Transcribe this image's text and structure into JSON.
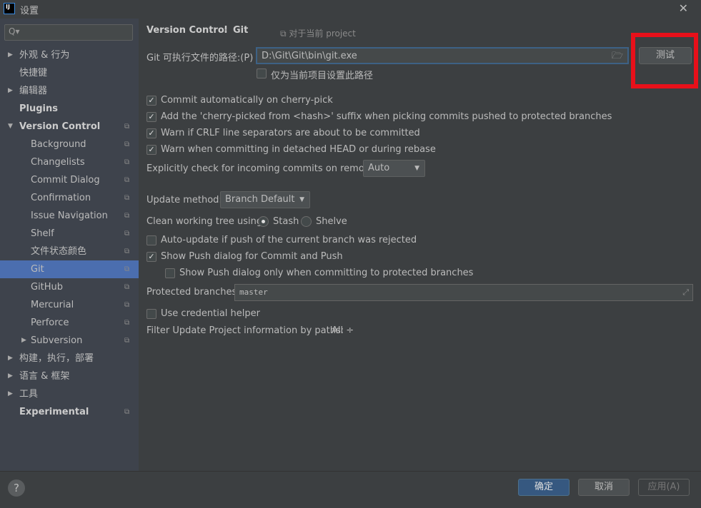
{
  "window": {
    "title": "设置",
    "logo": "IJ"
  },
  "sidebar": {
    "search_placeholder": "Q▾",
    "items": [
      {
        "label": "外观 & 行为",
        "arrow": "▶",
        "level": 0,
        "bold": false,
        "copy": false
      },
      {
        "label": "快捷键",
        "level": 0,
        "bold": false,
        "copy": false
      },
      {
        "label": "编辑器",
        "arrow": "▶",
        "level": 0,
        "bold": false,
        "copy": false
      },
      {
        "label": "Plugins",
        "level": 0,
        "bold": true,
        "copy": false
      },
      {
        "label": "Version Control",
        "arrow": "▼",
        "level": 0,
        "bold": true,
        "copy": true
      },
      {
        "label": "Background",
        "level": 1,
        "copy": true
      },
      {
        "label": "Changelists",
        "level": 1,
        "copy": true
      },
      {
        "label": "Commit Dialog",
        "level": 1,
        "copy": true
      },
      {
        "label": "Confirmation",
        "level": 1,
        "copy": true
      },
      {
        "label": "Issue Navigation",
        "level": 1,
        "copy": true
      },
      {
        "label": "Shelf",
        "level": 1,
        "copy": true
      },
      {
        "label": "文件状态颜色",
        "level": 1,
        "copy": true
      },
      {
        "label": "Git",
        "level": 1,
        "copy": true,
        "selected": true
      },
      {
        "label": "GitHub",
        "level": 1,
        "copy": true
      },
      {
        "label": "Mercurial",
        "level": 1,
        "copy": true
      },
      {
        "label": "Perforce",
        "level": 1,
        "copy": true
      },
      {
        "label": "Subversion",
        "arrow": "▶",
        "level": 1,
        "copy": true
      },
      {
        "label": "构建，执行，部署",
        "arrow": "▶",
        "level": 0
      },
      {
        "label": "语言 & 框架",
        "arrow": "▶",
        "level": 0
      },
      {
        "label": "工具",
        "arrow": "▶",
        "level": 0
      },
      {
        "label": "Experimental",
        "level": 0,
        "bold": true,
        "copy": true
      }
    ]
  },
  "main": {
    "breadcrumb": {
      "parent": "Version Control",
      "sep": "›",
      "current": "Git"
    },
    "scope": "对于当前 project",
    "git_path_label": "Git 可执行文件的路径:(P)",
    "git_path_value": "D:\\Git\\Git\\bin\\git.exe",
    "test_button": "测试",
    "project_only": {
      "label": "仅为当前项目设置此路径",
      "checked": false
    },
    "options": [
      {
        "label": "Commit automatically on cherry-pick",
        "checked": true
      },
      {
        "label": "Add the 'cherry-picked from <hash>' suffix when picking commits pushed to protected branches",
        "checked": true
      },
      {
        "label": "Warn if CRLF line separators are about to be committed",
        "checked": true
      },
      {
        "label": "Warn when committing in detached HEAD or during rebase",
        "checked": true
      }
    ],
    "incoming_label": "Explicitly check for incoming commits on remotes:",
    "incoming_value": "Auto",
    "update_label": "Update method:",
    "update_value": "Branch Default",
    "clean_label": "Clean working tree using:",
    "stash": "Stash",
    "shelve": "Shelve",
    "auto_update": {
      "label": "Auto-update if push of the current branch was rejected",
      "checked": false
    },
    "show_push": {
      "label": "Show Push dialog for Commit and Push",
      "checked": true
    },
    "show_push_protected": {
      "label": "Show Push dialog only when committing to protected branches",
      "checked": false
    },
    "protected_label": "Protected branches:",
    "protected_value": "master",
    "credential": {
      "label": "Use credential helper",
      "checked": false
    },
    "filter_label": "Filter Update Project information by paths:",
    "filter_value": "All ÷"
  },
  "footer": {
    "help": "?",
    "ok": "确定",
    "cancel": "取消",
    "apply": "应用(A)"
  },
  "colors": {
    "accent": "#4b6eaf",
    "highlight": "#e8101a"
  }
}
